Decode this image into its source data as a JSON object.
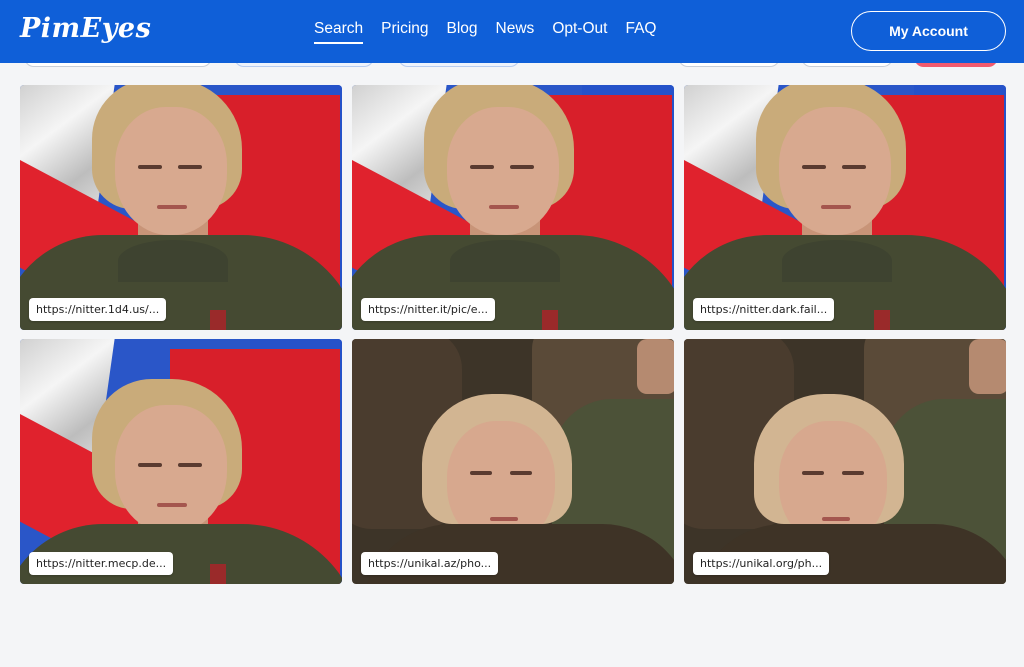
{
  "brand": {
    "logo_text": "PimEyes",
    "primary_color": "#0f5fd8"
  },
  "nav": {
    "items": [
      {
        "label": "Search",
        "active": true
      },
      {
        "label": "Pricing",
        "active": false
      },
      {
        "label": "Blog",
        "active": false
      },
      {
        "label": "News",
        "active": false
      },
      {
        "label": "Opt-Out",
        "active": false
      },
      {
        "label": "FAQ",
        "active": false
      }
    ],
    "account_label": "My Account"
  },
  "results": [
    {
      "url": "https://nitter.1d4.us/...",
      "scene": "flag"
    },
    {
      "url": "https://nitter.it/pic/e...",
      "scene": "flag"
    },
    {
      "url": "https://nitter.dark.fail...",
      "scene": "flag"
    },
    {
      "url": "https://nitter.mecp.de...",
      "scene": "flag"
    },
    {
      "url": "https://unikal.az/pho...",
      "scene": "crowd"
    },
    {
      "url": "https://unikal.org/ph...",
      "scene": "crowd"
    }
  ]
}
